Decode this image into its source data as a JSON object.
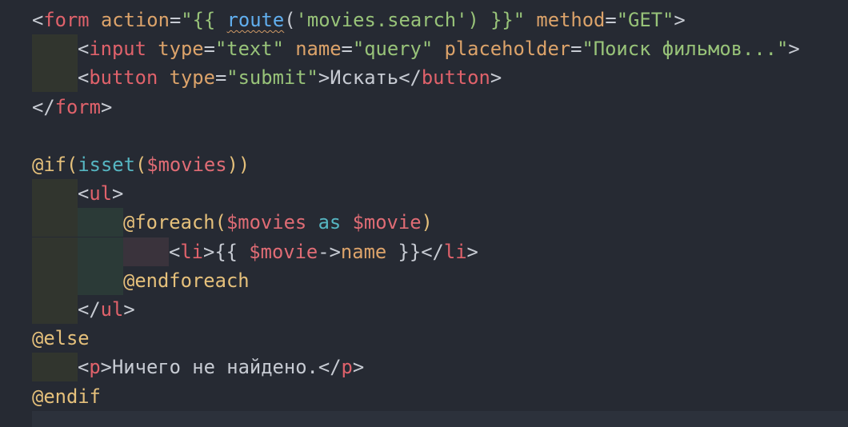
{
  "editor": {
    "lines": [
      {
        "indent": 0,
        "tokens": [
          {
            "t": "<",
            "k": "punct"
          },
          {
            "t": "form",
            "k": "tag"
          },
          {
            "t": " ",
            "k": "text"
          },
          {
            "t": "action",
            "k": "attr"
          },
          {
            "t": "=",
            "k": "punct"
          },
          {
            "t": "\"{{ ",
            "k": "str"
          },
          {
            "t": "route",
            "k": "method",
            "squiggle": true
          },
          {
            "t": "(",
            "k": "punct"
          },
          {
            "t": "'movies.search'",
            "k": "str"
          },
          {
            "t": ") }}\"",
            "k": "str"
          },
          {
            "t": " ",
            "k": "text"
          },
          {
            "t": "method",
            "k": "attr"
          },
          {
            "t": "=",
            "k": "punct"
          },
          {
            "t": "\"GET\"",
            "k": "str"
          },
          {
            "t": ">",
            "k": "punct"
          }
        ]
      },
      {
        "indent": 1,
        "tokens": [
          {
            "t": "<",
            "k": "punct"
          },
          {
            "t": "input",
            "k": "tag"
          },
          {
            "t": " ",
            "k": "text"
          },
          {
            "t": "type",
            "k": "attr"
          },
          {
            "t": "=",
            "k": "punct"
          },
          {
            "t": "\"text\"",
            "k": "str"
          },
          {
            "t": " ",
            "k": "text"
          },
          {
            "t": "name",
            "k": "attr"
          },
          {
            "t": "=",
            "k": "punct"
          },
          {
            "t": "\"query\"",
            "k": "str"
          },
          {
            "t": " ",
            "k": "text"
          },
          {
            "t": "placeholder",
            "k": "attr"
          },
          {
            "t": "=",
            "k": "punct"
          },
          {
            "t": "\"Поиск фильмов...\"",
            "k": "str"
          },
          {
            "t": ">",
            "k": "punct"
          }
        ]
      },
      {
        "indent": 1,
        "tokens": [
          {
            "t": "<",
            "k": "punct"
          },
          {
            "t": "button",
            "k": "tag"
          },
          {
            "t": " ",
            "k": "text"
          },
          {
            "t": "type",
            "k": "attr"
          },
          {
            "t": "=",
            "k": "punct"
          },
          {
            "t": "\"submit\"",
            "k": "str"
          },
          {
            "t": ">",
            "k": "punct"
          },
          {
            "t": "Искать",
            "k": "text"
          },
          {
            "t": "</",
            "k": "punct"
          },
          {
            "t": "button",
            "k": "tag"
          },
          {
            "t": ">",
            "k": "punct"
          }
        ]
      },
      {
        "indent": 0,
        "tokens": [
          {
            "t": "</",
            "k": "punct"
          },
          {
            "t": "form",
            "k": "tag"
          },
          {
            "t": ">",
            "k": "punct"
          }
        ]
      },
      {
        "indent": 0,
        "tokens": []
      },
      {
        "indent": 0,
        "tokens": [
          {
            "t": "@if",
            "k": "dir"
          },
          {
            "t": "(",
            "k": "dir"
          },
          {
            "t": "isset",
            "k": "fn"
          },
          {
            "t": "(",
            "k": "dir"
          },
          {
            "t": "$movies",
            "k": "var"
          },
          {
            "t": "))",
            "k": "dir"
          }
        ]
      },
      {
        "indent": 1,
        "tokens": [
          {
            "t": "<",
            "k": "punct"
          },
          {
            "t": "ul",
            "k": "tag"
          },
          {
            "t": ">",
            "k": "punct"
          }
        ]
      },
      {
        "indent": 2,
        "tokens": [
          {
            "t": "@foreach",
            "k": "dir"
          },
          {
            "t": "(",
            "k": "dir"
          },
          {
            "t": "$movies",
            "k": "var"
          },
          {
            "t": " ",
            "k": "text"
          },
          {
            "t": "as",
            "k": "kw"
          },
          {
            "t": " ",
            "k": "text"
          },
          {
            "t": "$movie",
            "k": "var"
          },
          {
            "t": ")",
            "k": "dir"
          }
        ]
      },
      {
        "indent": 3,
        "tokens": [
          {
            "t": "<",
            "k": "punct"
          },
          {
            "t": "li",
            "k": "tag"
          },
          {
            "t": ">",
            "k": "punct"
          },
          {
            "t": "{{ ",
            "k": "punct"
          },
          {
            "t": "$movie",
            "k": "var"
          },
          {
            "t": "->",
            "k": "punct"
          },
          {
            "t": "name",
            "k": "attr"
          },
          {
            "t": " }}",
            "k": "punct"
          },
          {
            "t": "</",
            "k": "punct"
          },
          {
            "t": "li",
            "k": "tag"
          },
          {
            "t": ">",
            "k": "punct"
          }
        ]
      },
      {
        "indent": 2,
        "tokens": [
          {
            "t": "@endforeach",
            "k": "dir"
          }
        ]
      },
      {
        "indent": 1,
        "tokens": [
          {
            "t": "</",
            "k": "punct"
          },
          {
            "t": "ul",
            "k": "tag"
          },
          {
            "t": ">",
            "k": "punct"
          }
        ]
      },
      {
        "indent": 0,
        "tokens": [
          {
            "t": "@else",
            "k": "dir"
          }
        ]
      },
      {
        "indent": 1,
        "tokens": [
          {
            "t": "<",
            "k": "punct"
          },
          {
            "t": "p",
            "k": "tag"
          },
          {
            "t": ">",
            "k": "punct"
          },
          {
            "t": "Ничего не найдено.",
            "k": "text"
          },
          {
            "t": "</",
            "k": "punct"
          },
          {
            "t": "p",
            "k": "tag"
          },
          {
            "t": ">",
            "k": "punct"
          }
        ]
      },
      {
        "indent": 0,
        "tokens": [
          {
            "t": "@endif",
            "k": "dir"
          }
        ]
      },
      {
        "indent": 0,
        "tokens": [],
        "current": true
      }
    ]
  },
  "colors": {
    "background": "#262a33",
    "tag": "#e0626b",
    "attribute": "#dca36a",
    "string": "#98c379",
    "directive": "#e5c07b",
    "variable": "#e06c75",
    "function": "#56b6c2"
  }
}
